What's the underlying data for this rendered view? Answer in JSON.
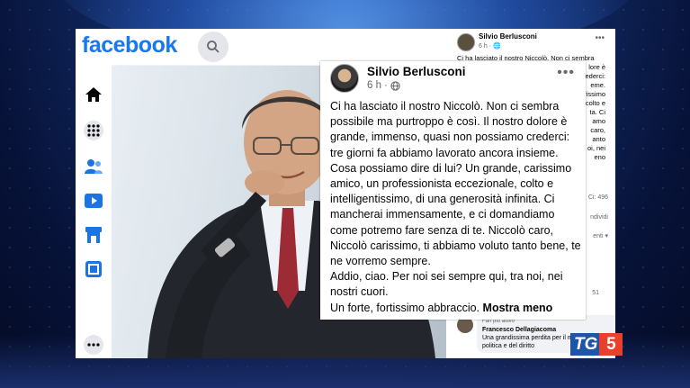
{
  "app": {
    "brand": "facebook",
    "brand_color": "#1877f2"
  },
  "nav_icons": [
    "home-icon",
    "apps-grid-icon",
    "friends-icon",
    "watch-icon",
    "marketplace-icon",
    "gaming-icon",
    "more-icon"
  ],
  "post": {
    "author": "Silvio Berlusconi",
    "time": "6 h",
    "privacy_icon": "globe-icon",
    "paragraphs": [
      "Ci ha lasciato il nostro Niccolò. Non ci sembra possibile ma purtroppo è così. Il nostro dolore è grande, immenso, quasi non possiamo crederci: tre giorni fa abbiamo lavorato ancora insieme. Cosa possiamo dire di lui? Un grande, carissimo amico, un professionista eccezionale, colto e intelligentissimo, di una generosità infinita. Ci mancherai immensamente, e ci domandiamo come potremo fare senza di te. Niccolò caro, Niccolò carissimo, ti abbiamo voluto tanto bene, te ne vorremo sempre.",
      "Addio, ciao. Per noi sei sempre qui, tra noi, nei nostri cuori.",
      "Un forte, fortissimo abbraccio."
    ],
    "see_less": "Mostra meno"
  },
  "background_post": {
    "author": "Silvio Berlusconi",
    "time": "6 h",
    "text_fragments": [
      "Ci ha lasciato il nostro Niccolò. Non ci sembra",
      "lore è",
      "crederci:",
      "eme.",
      "arissimo",
      "colto e",
      "ta. Ci",
      "amo",
      "caro,",
      "anto",
      "oi, nei",
      "eno"
    ],
    "reaction_count": "496",
    "share_label": "ndividi",
    "comments_label": "enti",
    "count_small": "51",
    "comment": {
      "badge": "Fan più attivo",
      "author": "Francesco Dellagiacoma",
      "text": "Una grandissima perdita per il mondo della politica e del diritto"
    }
  },
  "watermark": {
    "tg": "TG",
    "five": "5"
  }
}
